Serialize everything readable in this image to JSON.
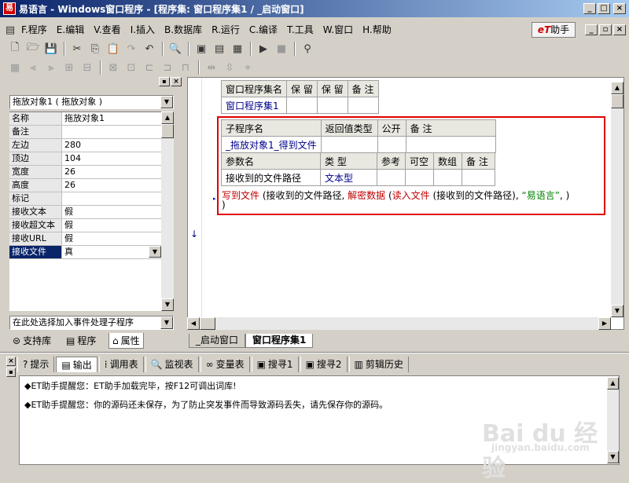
{
  "window": {
    "app_name": "易语言",
    "title": "易语言 - Windows窗口程序 - [程序集: 窗口程序集1 / _启动窗口]",
    "minimize": "_",
    "maximize": "□",
    "close": "×"
  },
  "menu": {
    "items": [
      "F.程序",
      "E.编辑",
      "V.查看",
      "I.插入",
      "B.数据库",
      "R.运行",
      "C.编译",
      "T.工具",
      "W.窗口",
      "H.帮助"
    ],
    "et_helper": "助手",
    "et_logo": "eT"
  },
  "left_panel": {
    "object_selector": "拖放对象1 ( 拖放对象 )",
    "properties": [
      {
        "name": "名称",
        "value": "拖放对象1"
      },
      {
        "name": "备注",
        "value": ""
      },
      {
        "name": "左边",
        "value": "280"
      },
      {
        "name": "顶边",
        "value": "104"
      },
      {
        "name": "宽度",
        "value": "26"
      },
      {
        "name": "高度",
        "value": "26"
      },
      {
        "name": "标记",
        "value": ""
      },
      {
        "name": "接收文本",
        "value": "假"
      },
      {
        "name": "接收超文本",
        "value": "假"
      },
      {
        "name": "接收URL",
        "value": "假"
      },
      {
        "name": "接收文件",
        "value": "真"
      }
    ],
    "event_selector": "在此处选择加入事件处理子程序",
    "tabs": [
      "支持库",
      "程序",
      "属性"
    ]
  },
  "editor": {
    "assembly_table": {
      "headers": [
        "窗口程序集名",
        "保 留",
        "保 留",
        "备 注"
      ],
      "row": [
        "窗口程序集1",
        "",
        "",
        ""
      ]
    },
    "sub_table": {
      "headers": [
        "子程序名",
        "返回值类型",
        "公开",
        "备 注"
      ],
      "row": [
        "_拖放对象1_得到文件",
        "",
        "",
        ""
      ]
    },
    "param_table": {
      "headers": [
        "参数名",
        "类 型",
        "参考",
        "可空",
        "数组",
        "备 注"
      ],
      "row": [
        "接收到的文件路径",
        "文本型",
        "",
        "",
        "",
        ""
      ]
    },
    "code": {
      "cmd1": "写到文件",
      "part1": " (接收到的文件路径, ",
      "cmd2": "解密数据",
      "part2": " (",
      "cmd3": "读入文件",
      "part3": " (接收到的文件路径), ",
      "str": "“易语言”",
      "part4": ", )",
      "line2": ")"
    },
    "tabs": [
      "_启动窗口",
      "窗口程序集1"
    ]
  },
  "output": {
    "tabs": [
      "提示",
      "输出",
      "调用表",
      "监视表",
      "变量表",
      "搜寻1",
      "搜寻2",
      "剪辑历史"
    ],
    "lines": [
      "◆ET助手提醒您：ET助手加载完毕，按F12可调出词库!",
      "◆ET助手提醒您：你的源码还未保存，为了防止突发事件而导致源码丢失，请先保存你的源码。"
    ]
  },
  "watermark": {
    "brand": "Bai du 经验",
    "url": "jingyan.baidu.com"
  }
}
